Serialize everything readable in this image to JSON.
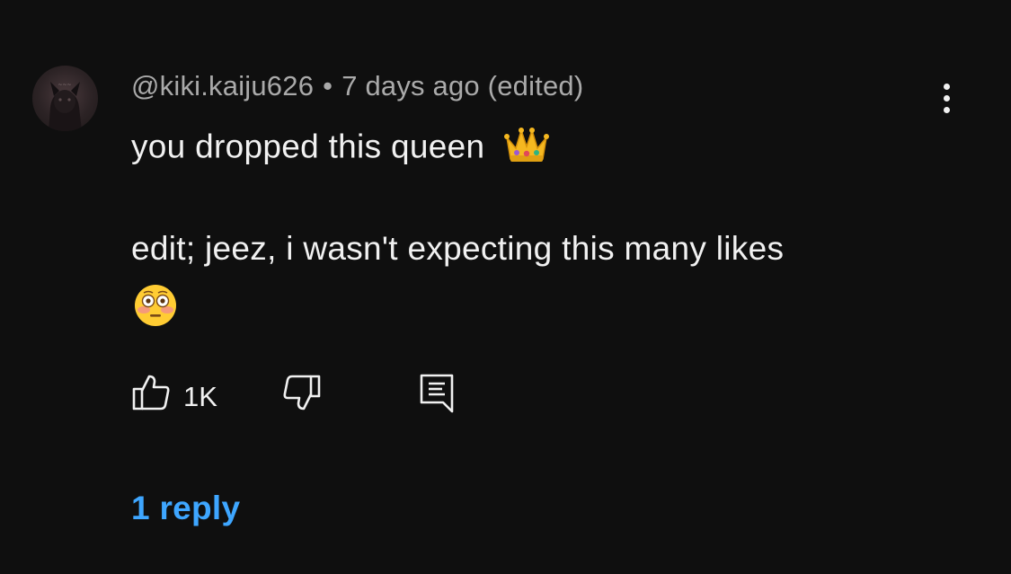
{
  "comment": {
    "author": "@kiki.kaiju626",
    "separator": "•",
    "timestamp": "7 days ago (edited)",
    "text_line1": "you dropped this queen",
    "text_line1_emoji": "crown-emoji",
    "text_line2": "edit; jeez, i wasn't expecting this many likes",
    "text_line3_emoji": "flushed-face-emoji"
  },
  "actions": {
    "like_count": "1K",
    "like_icon": "thumbs-up-icon",
    "dislike_icon": "thumbs-down-icon",
    "reply_icon": "comment-icon",
    "more_icon": "more-vertical-icon"
  },
  "replies": {
    "label": "1 reply"
  },
  "colors": {
    "background": "#0f0f0f",
    "primary_text": "#f1f1f1",
    "secondary_text": "#aaaaaa",
    "link": "#3ea6ff"
  }
}
